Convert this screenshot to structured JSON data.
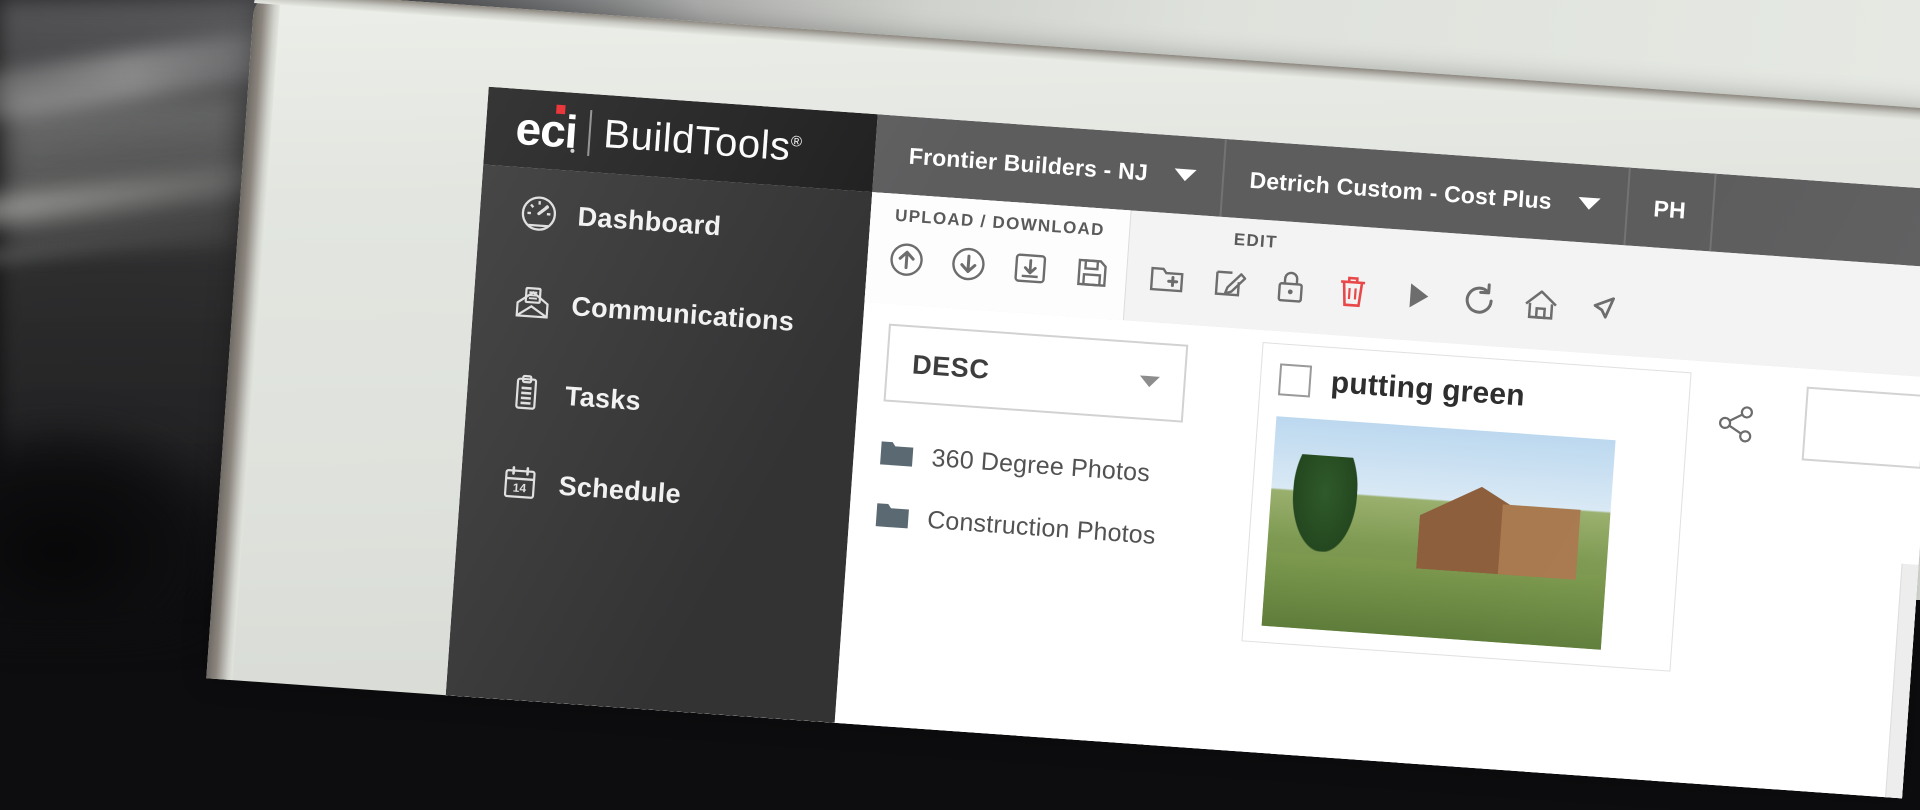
{
  "app": {
    "logo_primary": "eci",
    "logo_secondary": "BuildTools",
    "logo_registered": "®"
  },
  "sidebar": {
    "items": [
      {
        "label": "Dashboard",
        "icon": "gauge-icon"
      },
      {
        "label": "Communications",
        "icon": "envelope-icon"
      },
      {
        "label": "Tasks",
        "icon": "clipboard-icon"
      },
      {
        "label": "Schedule",
        "icon": "calendar-14-icon"
      }
    ]
  },
  "tabs": [
    {
      "label": "Frontier Builders - NJ",
      "caret": "chevron-down-icon"
    },
    {
      "label": "Detrich Custom - Cost Plus",
      "caret": "chevron-down-icon"
    },
    {
      "label": "PH",
      "caret": "chevron-down-icon"
    }
  ],
  "toolbar": {
    "groups": [
      {
        "label": "UPLOAD / DOWNLOAD",
        "icons": [
          "upload-arrow-icon",
          "download-arrow-icon",
          "download-tray-icon",
          "save-disk-icon"
        ]
      },
      {
        "label": "EDIT",
        "icons": [
          "new-folder-icon",
          "edit-pencil-icon",
          "lock-icon",
          "delete-trash-icon"
        ]
      },
      {
        "label": "",
        "icons": [
          "play-icon",
          "refresh-icon",
          "home-icon",
          "move-arrow-icon"
        ]
      }
    ]
  },
  "content": {
    "sort": {
      "value": "DESC",
      "caret": "chevron-down-icon"
    },
    "folders": [
      {
        "name": "360 Degree Photos",
        "icon": "folder-icon"
      },
      {
        "name": "Construction Photos",
        "icon": "folder-icon"
      }
    ],
    "photo_card": {
      "title": "putting green",
      "checkbox": "unchecked",
      "side_icon": "share-nodes-icon"
    }
  },
  "colors": {
    "logo_accent": "#e8252a",
    "sidebar_bg": "#333334",
    "logo_bar_bg": "#1f1f20",
    "tabbar_bg": "#5d5d5e",
    "delete_red": "#e8484a",
    "laptop_shell": "#e3e6e0"
  }
}
